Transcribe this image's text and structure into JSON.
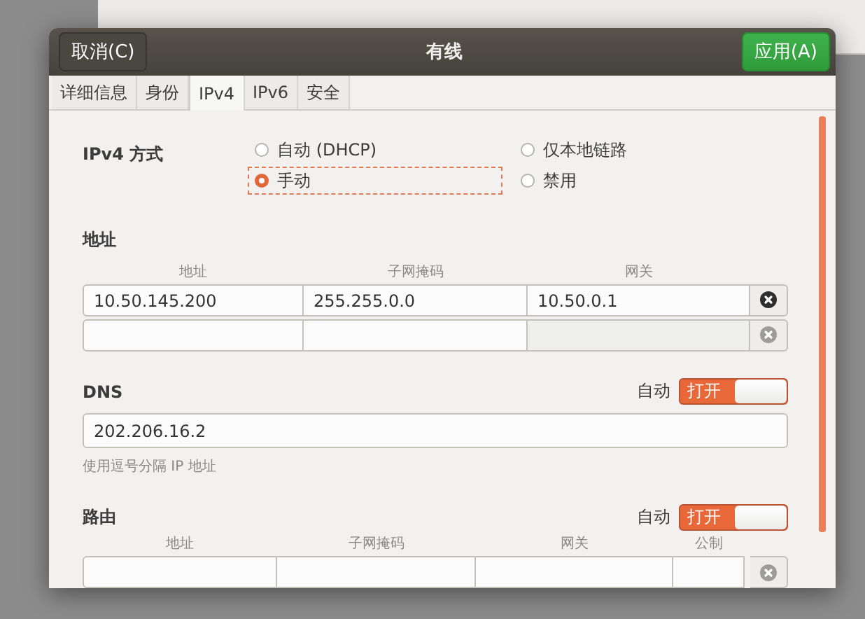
{
  "window": {
    "title": "有线",
    "cancel_button": "取消(C)",
    "apply_button": "应用(A)"
  },
  "tabs": [
    {
      "label": "详细信息",
      "selected": false
    },
    {
      "label": "身份",
      "selected": false
    },
    {
      "label": "IPv4",
      "selected": true
    },
    {
      "label": "IPv6",
      "selected": false
    },
    {
      "label": "安全",
      "selected": false
    }
  ],
  "method": {
    "label": "IPv4 方式",
    "options": [
      {
        "label": "自动 (DHCP)",
        "selected": false
      },
      {
        "label": "仅本地链路",
        "selected": false
      },
      {
        "label": "手动",
        "selected": true
      },
      {
        "label": "禁用",
        "selected": false
      }
    ]
  },
  "addresses": {
    "heading": "地址",
    "columns": [
      "地址",
      "子网掩码",
      "网关"
    ],
    "rows": [
      {
        "values": [
          "10.50.145.200",
          "255.255.0.0",
          "10.50.0.1"
        ],
        "removable": true
      },
      {
        "removable": false
      }
    ]
  },
  "dns": {
    "heading": "DNS",
    "auto_label": "自动",
    "auto": true,
    "switch_label": "打开",
    "value": "202.206.16.2",
    "hint": "使用逗号分隔 IP 地址"
  },
  "routes": {
    "heading": "路由",
    "auto_label": "自动",
    "auto": true,
    "switch_label": "打开",
    "columns": [
      "地址",
      "子网掩码",
      "网关",
      "公制"
    ],
    "rows": [
      {
        "removable": false
      }
    ]
  }
}
